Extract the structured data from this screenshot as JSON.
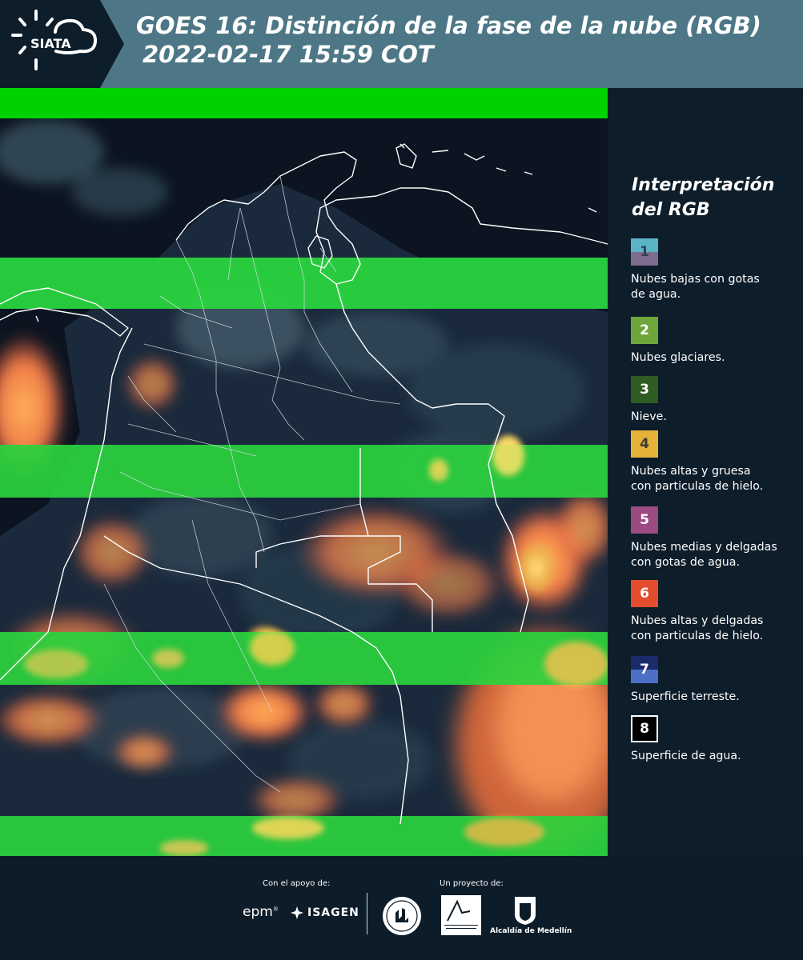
{
  "header": {
    "logo_text": "SIATA",
    "title_line_1": "GOES 16: Distinción de la fase de la nube (RGB)",
    "title_line_2": "2022-02-17 15:59 COT",
    "background_color": "#4d7786"
  },
  "legend": {
    "title_line_1": "Interpretación",
    "title_line_2": "del RGB",
    "items": [
      {
        "number": "1",
        "label_lines": [
          "Nubes bajas con gotas",
          "de agua."
        ],
        "color_top": "#5bb3c6",
        "color_bottom": "#7e6d8e",
        "text_color": "#3a3f52"
      },
      {
        "number": "2",
        "label_lines": [
          "Nubes glaciares."
        ],
        "color_top": "#6fa63c",
        "color_bottom": "#6fa63c",
        "text_color": "#ffffff"
      },
      {
        "number": "3",
        "label_lines": [
          "Nieve."
        ],
        "color_top": "#2f5c22",
        "color_bottom": "#2f5c22",
        "text_color": "#ffffff"
      },
      {
        "number": "4",
        "label_lines": [
          "Nubes altas y gruesa",
          "con particulas de hielo."
        ],
        "color_top": "#e7b23a",
        "color_bottom": "#e7b23a",
        "text_color": "#3a3a3a"
      },
      {
        "number": "5",
        "label_lines": [
          "Nubes medias y delgadas",
          "con gotas de agua."
        ],
        "color_top": "#9c4a82",
        "color_bottom": "#9c4a82",
        "text_color": "#ffffff"
      },
      {
        "number": "6",
        "label_lines": [
          "Nubes altas y delgadas",
          "con particulas de hielo."
        ],
        "color_top": "#e34c2c",
        "color_bottom": "#e34c2c",
        "text_color": "#ffffff"
      },
      {
        "number": "7",
        "label_lines": [
          "Superficie terreste."
        ],
        "color_top": "#1a2a6a",
        "color_bottom": "#4a6fc4",
        "text_color": "#ffffff"
      },
      {
        "number": "8",
        "label_lines": [
          "Superficie de agua."
        ],
        "color_top": "#000000",
        "color_bottom": "#000000",
        "text_color": "#ffffff",
        "border": "#ffffff"
      }
    ]
  },
  "footer": {
    "support_label": "Con el apoyo de:",
    "project_label": "Un proyecto de:",
    "sponsor_1": "epm",
    "sponsor_2": "ISAGEN",
    "partner_2": "Área Metropolitana Valle de Aburrá",
    "partner_3": "Alcaldía de Medellín"
  }
}
